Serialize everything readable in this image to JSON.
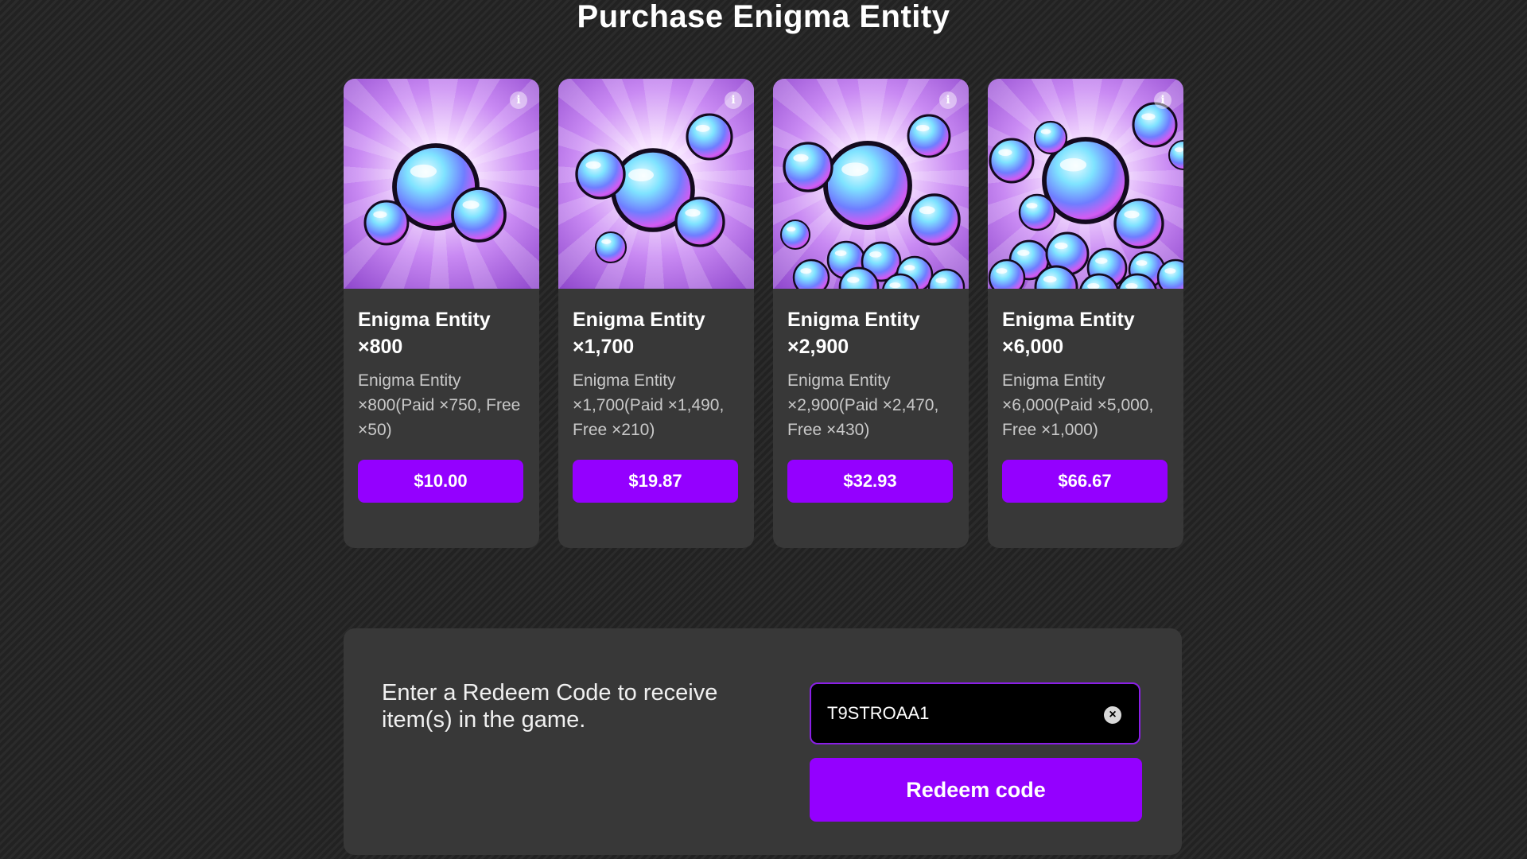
{
  "page": {
    "title": "Purchase Enigma Entity"
  },
  "products": [
    {
      "name": "Enigma Entity ×800",
      "description": "Enigma Entity ×800(Paid ×750, Free ×50)",
      "price": "$10.00",
      "image_icon": "gem-bundle-small-icon"
    },
    {
      "name": "Enigma Entity ×1,700",
      "description": "Enigma Entity ×1,700(Paid ×1,490, Free ×210)",
      "price": "$19.87",
      "image_icon": "gem-bundle-medium-icon"
    },
    {
      "name": "Enigma Entity ×2,900",
      "description": "Enigma Entity ×2,900(Paid ×2,470, Free ×430)",
      "price": "$32.93",
      "image_icon": "gem-bundle-large-icon"
    },
    {
      "name": "Enigma Entity ×6,000",
      "description": "Enigma Entity ×6,000(Paid ×5,000, Free ×1,000)",
      "price": "$66.67",
      "image_icon": "gem-bundle-huge-icon"
    }
  ],
  "redeem": {
    "prompt": "Enter a Redeem Code to receive item(s) in the game.",
    "code_value": "T9STROAA1",
    "button_label": "Redeem code"
  },
  "icons": {
    "info": "info-icon",
    "clear": "clear-icon"
  },
  "colors": {
    "accent": "#9400ff",
    "card_background": "#383838",
    "input_border": "#8a1fe6"
  }
}
